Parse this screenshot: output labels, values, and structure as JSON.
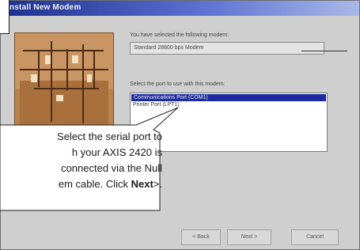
{
  "window": {
    "title": "Install New Modem"
  },
  "dialog": {
    "selected_label": "You have selected the following modem:",
    "modem_name": "Standard 28800 bps Modem",
    "port_prompt": "Select the port to use with this modem:",
    "ports": [
      {
        "label": "Communications Port (COM1)",
        "selected": true
      },
      {
        "label": "Printer Port (LPT1)",
        "selected": false
      }
    ]
  },
  "buttons": {
    "back": "< Back",
    "next": "Next >",
    "cancel": "Cancel"
  },
  "callout": {
    "lines": [
      "Select the serial port to",
      "h your AXIS 2420 is",
      "connected via the Null"
    ],
    "last_line_prefix": "em cable. Click ",
    "last_line_bold": "Next",
    "last_line_suffix": ">."
  },
  "colors": {
    "title_gradient_start": "#1c2f8f",
    "selection": "#1d2b9e",
    "dialog_face": "#cfcfcf"
  }
}
